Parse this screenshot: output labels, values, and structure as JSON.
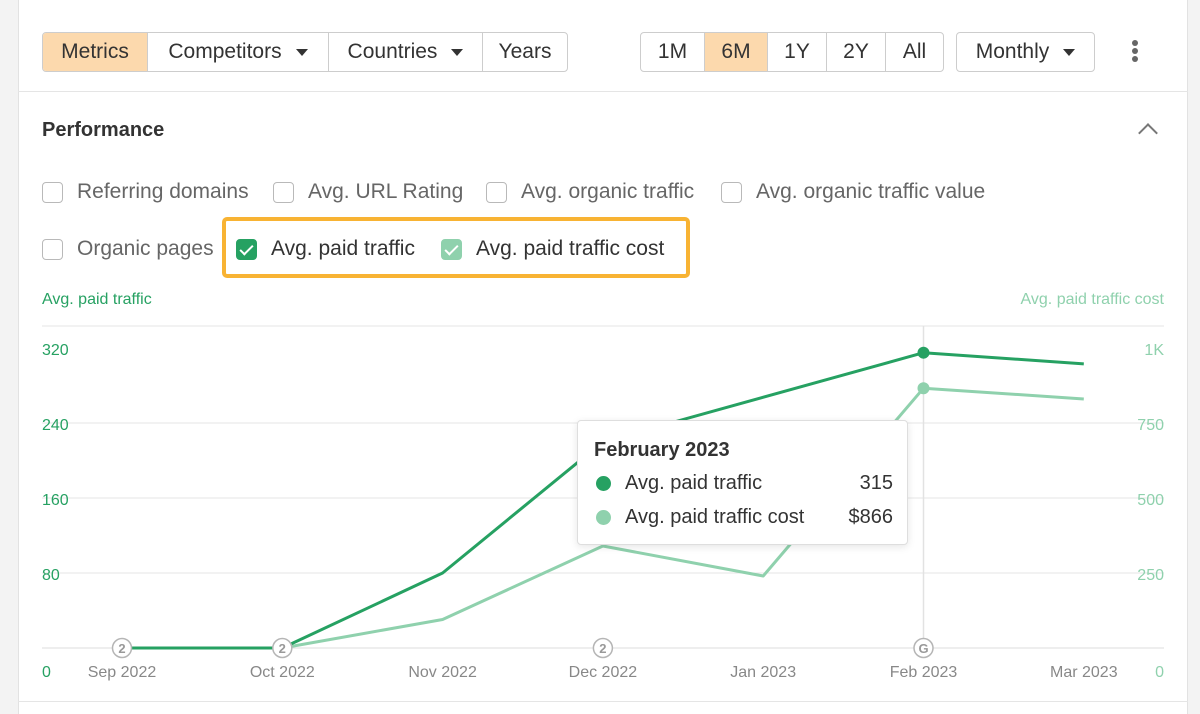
{
  "toolbar": {
    "left_group": [
      {
        "label": "Metrics",
        "active": true,
        "caret": false
      },
      {
        "label": "Competitors",
        "active": false,
        "caret": true
      },
      {
        "label": "Countries",
        "active": false,
        "caret": true
      },
      {
        "label": "Years",
        "active": false,
        "caret": false
      }
    ],
    "range_group": [
      {
        "label": "1M",
        "active": false
      },
      {
        "label": "6M",
        "active": true
      },
      {
        "label": "1Y",
        "active": false
      },
      {
        "label": "2Y",
        "active": false
      },
      {
        "label": "All",
        "active": false
      }
    ],
    "interval_label": "Monthly",
    "more_icon": "kebab-vertical-icon"
  },
  "section": {
    "title": "Performance",
    "collapse_icon": "chevron-up-icon"
  },
  "checkboxes": {
    "referring_domains": {
      "label": "Referring domains",
      "checked": false
    },
    "avg_url_rating": {
      "label": "Avg. URL Rating",
      "checked": false
    },
    "avg_organic_traffic": {
      "label": "Avg. organic traffic",
      "checked": false
    },
    "avg_organic_traffic_value": {
      "label": "Avg. organic traffic value",
      "checked": false
    },
    "organic_pages": {
      "label": "Organic pages",
      "checked": false
    },
    "avg_paid_traffic": {
      "label": "Avg. paid traffic",
      "checked": true
    },
    "avg_paid_traffic_cost": {
      "label": "Avg. paid traffic cost",
      "checked": true
    }
  },
  "colors": {
    "accent": "#fcd9ad",
    "highlight": "#f8b333",
    "series_dark": "#26a162",
    "series_light": "#8fd1ad"
  },
  "chart_data": {
    "type": "line",
    "categories": [
      "Sep 2022",
      "Oct 2022",
      "Nov 2022",
      "Dec 2022",
      "Jan 2023",
      "Feb 2023",
      "Mar 2023"
    ],
    "series": [
      {
        "name": "Avg. paid traffic",
        "axis": "left",
        "color": "#26a162",
        "values": [
          0,
          0,
          80,
          220,
          null,
          315,
          303
        ]
      },
      {
        "name": "Avg. paid traffic cost",
        "axis": "right",
        "color": "#8fd1ad",
        "values": [
          0,
          0,
          95,
          340,
          240,
          866,
          830
        ]
      }
    ],
    "ylabel_left": "Avg. paid traffic",
    "ylabel_right": "Avg. paid traffic cost",
    "ylim_left": [
      0,
      320
    ],
    "yticks_left": [
      "0",
      "80",
      "160",
      "240",
      "320"
    ],
    "ylim_right": [
      0,
      1000
    ],
    "yticks_right": [
      "0",
      "250",
      "500",
      "750",
      "1K"
    ],
    "annotations": [
      {
        "category": "Sep 2022",
        "label": "2"
      },
      {
        "category": "Oct 2022",
        "label": "2"
      },
      {
        "category": "Dec 2022",
        "label": "2"
      },
      {
        "category": "Feb 2023",
        "label": "G"
      }
    ],
    "grid": true,
    "tooltip": {
      "title": "February 2023",
      "rows": [
        {
          "label": "Avg. paid traffic",
          "value": "315"
        },
        {
          "label": "Avg. paid traffic cost",
          "value": "$866"
        }
      ]
    }
  }
}
